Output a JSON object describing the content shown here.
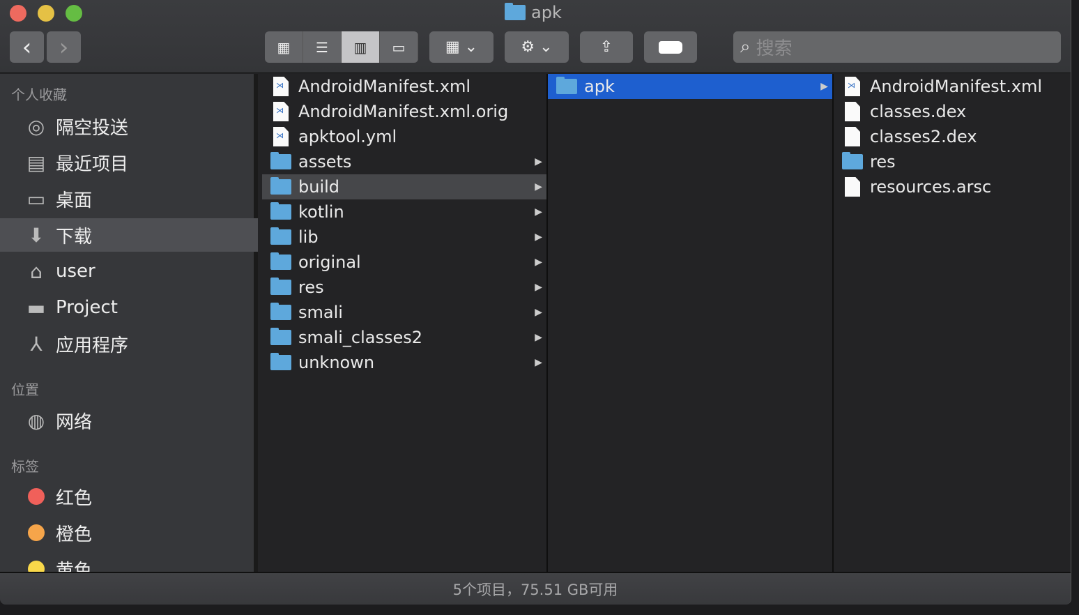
{
  "window": {
    "title": "apk"
  },
  "toolbar": {
    "back": "‹",
    "forward": "›",
    "search_placeholder": "搜索"
  },
  "sidebar": {
    "favorites_header": "个人收藏",
    "favorites": [
      {
        "label": "隔空投送",
        "icon": "airdrop-icon",
        "glyph": "◎"
      },
      {
        "label": "最近项目",
        "icon": "recents-icon",
        "glyph": "▤"
      },
      {
        "label": "桌面",
        "icon": "desktop-icon",
        "glyph": "▭"
      },
      {
        "label": "下载",
        "icon": "downloads-icon",
        "glyph": "⬇"
      },
      {
        "label": "user",
        "icon": "home-icon",
        "glyph": "⌂"
      },
      {
        "label": "Project",
        "icon": "folder-icon",
        "glyph": "▬"
      },
      {
        "label": "应用程序",
        "icon": "applications-icon",
        "glyph": "⅄"
      }
    ],
    "locations_header": "位置",
    "locations": [
      {
        "label": "网络",
        "icon": "network-icon",
        "glyph": "◍"
      }
    ],
    "tags_header": "标签",
    "tags": [
      {
        "label": "红色",
        "color": "#f0605a"
      },
      {
        "label": "橙色",
        "color": "#f6a54a"
      },
      {
        "label": "黄色",
        "color": "#f9d84a"
      }
    ]
  },
  "columns": [
    {
      "items": [
        {
          "name": "AndroidManifest.xml",
          "type": "xml"
        },
        {
          "name": "AndroidManifest.xml.orig",
          "type": "xml"
        },
        {
          "name": "apktool.yml",
          "type": "xml"
        },
        {
          "name": "assets",
          "type": "folder"
        },
        {
          "name": "build",
          "type": "folder",
          "state": "grey"
        },
        {
          "name": "kotlin",
          "type": "folder"
        },
        {
          "name": "lib",
          "type": "folder"
        },
        {
          "name": "original",
          "type": "folder"
        },
        {
          "name": "res",
          "type": "folder"
        },
        {
          "name": "smali",
          "type": "folder"
        },
        {
          "name": "smali_classes2",
          "type": "folder"
        },
        {
          "name": "unknown",
          "type": "folder"
        }
      ]
    },
    {
      "items": [
        {
          "name": "apk",
          "type": "folder",
          "state": "blue"
        }
      ]
    },
    {
      "items": [
        {
          "name": "AndroidManifest.xml",
          "type": "xml"
        },
        {
          "name": "classes.dex",
          "type": "file"
        },
        {
          "name": "classes2.dex",
          "type": "file"
        },
        {
          "name": "res",
          "type": "folder",
          "noarrow": true
        },
        {
          "name": "resources.arsc",
          "type": "file"
        }
      ]
    }
  ],
  "status": "5个项目，75.51 GB可用",
  "colors": {
    "selection": "#1e5fcf",
    "accent_folder": "#5ea8dc"
  }
}
